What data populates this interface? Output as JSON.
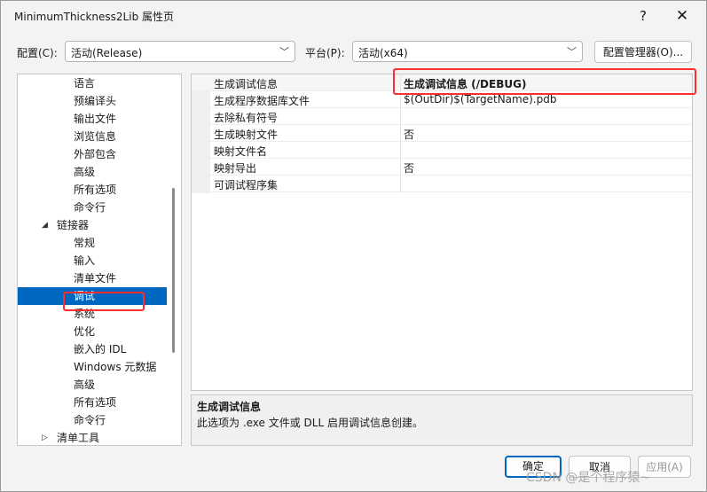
{
  "window": {
    "title": "MinimumThickness2Lib 属性页",
    "help": "?",
    "close": "✕"
  },
  "config": {
    "config_label": "配置(C):",
    "config_value": "活动(Release)",
    "platform_label": "平台(P):",
    "platform_value": "活动(x64)",
    "manager_button": "配置管理器(O)..."
  },
  "tree": {
    "items": [
      {
        "label": "语言",
        "level": 2
      },
      {
        "label": "预编译头",
        "level": 2
      },
      {
        "label": "输出文件",
        "level": 2
      },
      {
        "label": "浏览信息",
        "level": 2
      },
      {
        "label": "外部包含",
        "level": 2
      },
      {
        "label": "高级",
        "level": 2
      },
      {
        "label": "所有选项",
        "level": 2
      },
      {
        "label": "命令行",
        "level": 2
      },
      {
        "label": "链接器",
        "level": 1,
        "expander": "◢"
      },
      {
        "label": "常规",
        "level": 2
      },
      {
        "label": "输入",
        "level": 2
      },
      {
        "label": "清单文件",
        "level": 2
      },
      {
        "label": "调试",
        "level": 2,
        "selected": true
      },
      {
        "label": "系统",
        "level": 2
      },
      {
        "label": "优化",
        "level": 2
      },
      {
        "label": "嵌入的 IDL",
        "level": 2
      },
      {
        "label": "Windows 元数据",
        "level": 2
      },
      {
        "label": "高级",
        "level": 2
      },
      {
        "label": "所有选项",
        "level": 2
      },
      {
        "label": "命令行",
        "level": 2
      },
      {
        "label": "清单工具",
        "level": 1,
        "expander": "▷"
      }
    ]
  },
  "properties": [
    {
      "name": "生成调试信息",
      "value": "生成调试信息 (/DEBUG)",
      "bold": true
    },
    {
      "name": "生成程序数据库文件",
      "value": "$(OutDir)$(TargetName).pdb"
    },
    {
      "name": "去除私有符号",
      "value": ""
    },
    {
      "name": "生成映射文件",
      "value": "否"
    },
    {
      "name": "映射文件名",
      "value": ""
    },
    {
      "name": "映射导出",
      "value": "否"
    },
    {
      "name": "可调试程序集",
      "value": ""
    }
  ],
  "description": {
    "title": "生成调试信息",
    "text": "此选项为 .exe 文件或 DLL 启用调试信息创建。"
  },
  "buttons": {
    "ok": "确定",
    "cancel": "取消",
    "apply": "应用(A)"
  },
  "watermark": "CSDN @是个程序猿~",
  "colors": {
    "selection": "#0067c0",
    "highlight_box": "#ff2d2d"
  }
}
